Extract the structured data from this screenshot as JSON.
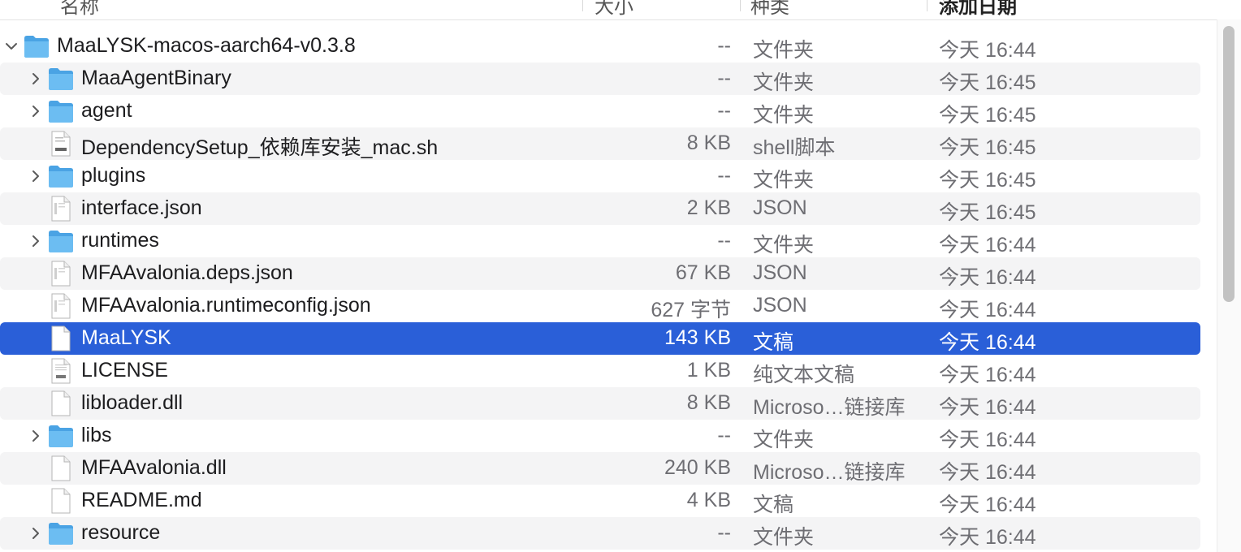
{
  "header": {
    "columns": [
      {
        "label": "名称"
      },
      {
        "label": "大小"
      },
      {
        "label": "种类"
      },
      {
        "label": "添加日期"
      }
    ]
  },
  "colors": {
    "selection": "#2a5fd8",
    "folder_blue": "#5bb2ec",
    "alt_row": "#f4f4f5"
  },
  "rows": [
    {
      "name": "MaaLYSK-macos-aarch64-v0.3.8",
      "size": "--",
      "kind": "文件夹",
      "date": "今天 16:44",
      "icon": "folder-icon",
      "disclosure": "chevron-down-icon"
    },
    {
      "name": "MaaAgentBinary",
      "size": "--",
      "kind": "文件夹",
      "date": "今天 16:45",
      "icon": "folder-icon",
      "disclosure": "chevron-right-icon"
    },
    {
      "name": "agent",
      "size": "--",
      "kind": "文件夹",
      "date": "今天 16:45",
      "icon": "folder-icon",
      "disclosure": "chevron-right-icon"
    },
    {
      "name": "DependencySetup_依赖库安装_mac.sh",
      "size": "8 KB",
      "kind": "shell脚本",
      "date": "今天 16:45",
      "icon": "shell-script-icon",
      "disclosure": ""
    },
    {
      "name": "plugins",
      "size": "--",
      "kind": "文件夹",
      "date": "今天 16:45",
      "icon": "folder-icon",
      "disclosure": "chevron-right-icon"
    },
    {
      "name": "interface.json",
      "size": "2 KB",
      "kind": "JSON",
      "date": "今天 16:45",
      "icon": "json-file-icon",
      "disclosure": ""
    },
    {
      "name": "runtimes",
      "size": "--",
      "kind": "文件夹",
      "date": "今天 16:44",
      "icon": "folder-icon",
      "disclosure": "chevron-right-icon"
    },
    {
      "name": "MFAAvalonia.deps.json",
      "size": "67 KB",
      "kind": "JSON",
      "date": "今天 16:44",
      "icon": "json-file-icon",
      "disclosure": ""
    },
    {
      "name": "MFAAvalonia.runtimeconfig.json",
      "size": "627 字节",
      "kind": "JSON",
      "date": "今天 16:44",
      "icon": "json-file-icon",
      "disclosure": ""
    },
    {
      "name": "MaaLYSK",
      "size": "143 KB",
      "kind": "文稿",
      "date": "今天 16:44",
      "icon": "document-icon",
      "disclosure": "",
      "selected": true
    },
    {
      "name": "LICENSE",
      "size": "1 KB",
      "kind": "纯文本文稿",
      "date": "今天 16:44",
      "icon": "text-file-icon",
      "disclosure": ""
    },
    {
      "name": "libloader.dll",
      "size": "8 KB",
      "kind": "Microso…链接库",
      "date": "今天 16:44",
      "icon": "document-icon",
      "disclosure": ""
    },
    {
      "name": "libs",
      "size": "--",
      "kind": "文件夹",
      "date": "今天 16:44",
      "icon": "folder-icon",
      "disclosure": "chevron-right-icon"
    },
    {
      "name": "MFAAvalonia.dll",
      "size": "240 KB",
      "kind": "Microso…链接库",
      "date": "今天 16:44",
      "icon": "document-icon",
      "disclosure": ""
    },
    {
      "name": "README.md",
      "size": "4 KB",
      "kind": "文稿",
      "date": "今天 16:44",
      "icon": "document-icon",
      "disclosure": ""
    },
    {
      "name": "resource",
      "size": "--",
      "kind": "文件夹",
      "date": "今天 16:44",
      "icon": "folder-icon",
      "disclosure": "chevron-right-icon"
    }
  ]
}
